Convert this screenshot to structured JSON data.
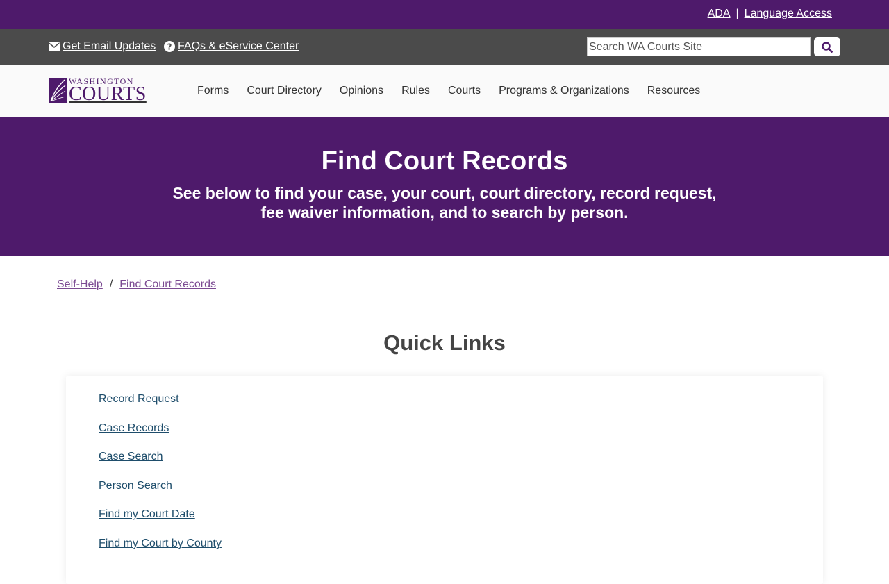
{
  "topbar": {
    "ada": "ADA",
    "separator": "|",
    "language_access": "Language Access"
  },
  "utility": {
    "email_updates": "Get Email Updates",
    "faqs": "FAQs & eService Center",
    "search_placeholder": "Search WA Courts Site"
  },
  "logo": {
    "line1": "WASHINGTON",
    "line2": "COURTS"
  },
  "nav": {
    "items": [
      "Forms",
      "Court Directory",
      "Opinions",
      "Rules",
      "Courts",
      "Programs & Organizations",
      "Resources"
    ]
  },
  "hero": {
    "title": "Find Court Records",
    "subtitle_line1": "See below to find your case, your court, court directory, record request,",
    "subtitle_line2": "fee waiver information, and to search by person."
  },
  "breadcrumb": {
    "items": [
      "Self-Help",
      "Find Court Records"
    ],
    "separator": "/"
  },
  "quick_links": {
    "title": "Quick Links",
    "items": [
      "Record Request",
      "Case Records",
      "Case Search",
      "Person Search",
      "Find my Court Date",
      "Find my Court by County"
    ]
  },
  "colors": {
    "brand_purple": "#4e1a6b",
    "utility_gray": "#4b4b4b",
    "link_blue": "#1e4d6b",
    "breadcrumb_purple": "#7b4a92"
  }
}
